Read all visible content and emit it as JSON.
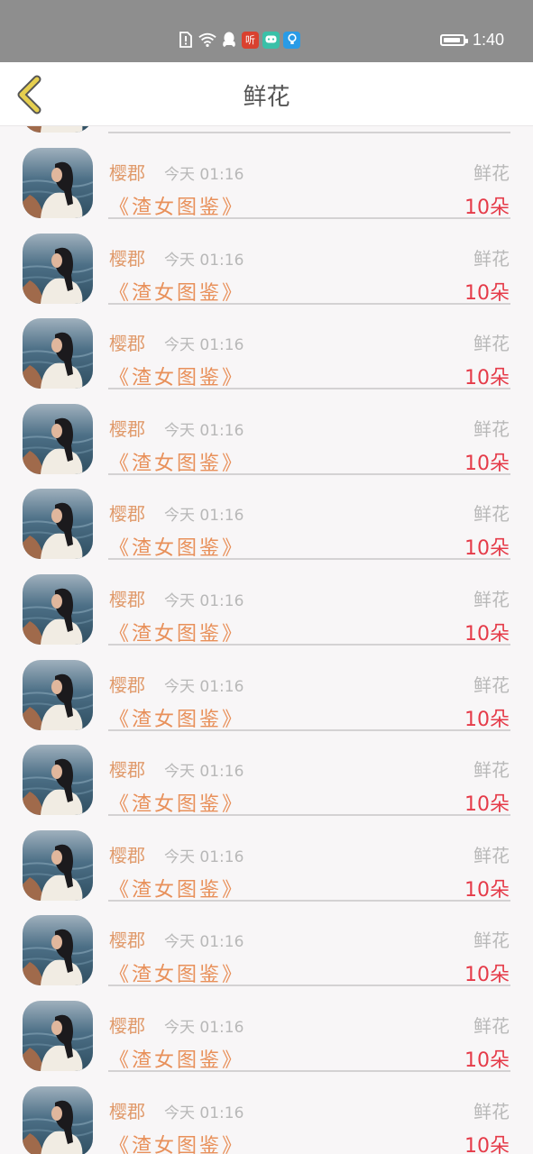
{
  "status_bar": {
    "time": "1:40",
    "battery_percent": 90,
    "icons": [
      "sim-alert-icon",
      "wifi-icon",
      "qq-icon",
      "ting-app-icon",
      "chat-app-icon",
      "bulb-app-icon"
    ],
    "apps": {
      "ting": "听"
    }
  },
  "header": {
    "title": "鲜花",
    "back_icon": "chevron-left-icon"
  },
  "colors": {
    "accent_name": "#e09a6b",
    "quantity": "#e53b49",
    "back_icon": "#e6cf4f"
  },
  "rows": [
    {
      "user": "樱郡",
      "time": "今天 01:16",
      "gift": "鲜花",
      "book": "《渣女图鉴》",
      "quantity": "10朵"
    },
    {
      "user": "樱郡",
      "time": "今天 01:16",
      "gift": "鲜花",
      "book": "《渣女图鉴》",
      "quantity": "10朵"
    },
    {
      "user": "樱郡",
      "time": "今天 01:16",
      "gift": "鲜花",
      "book": "《渣女图鉴》",
      "quantity": "10朵"
    },
    {
      "user": "樱郡",
      "time": "今天 01:16",
      "gift": "鲜花",
      "book": "《渣女图鉴》",
      "quantity": "10朵"
    },
    {
      "user": "樱郡",
      "time": "今天 01:16",
      "gift": "鲜花",
      "book": "《渣女图鉴》",
      "quantity": "10朵"
    },
    {
      "user": "樱郡",
      "time": "今天 01:16",
      "gift": "鲜花",
      "book": "《渣女图鉴》",
      "quantity": "10朵"
    },
    {
      "user": "樱郡",
      "time": "今天 01:16",
      "gift": "鲜花",
      "book": "《渣女图鉴》",
      "quantity": "10朵"
    },
    {
      "user": "樱郡",
      "time": "今天 01:16",
      "gift": "鲜花",
      "book": "《渣女图鉴》",
      "quantity": "10朵"
    },
    {
      "user": "樱郡",
      "time": "今天 01:16",
      "gift": "鲜花",
      "book": "《渣女图鉴》",
      "quantity": "10朵"
    },
    {
      "user": "樱郡",
      "time": "今天 01:16",
      "gift": "鲜花",
      "book": "《渣女图鉴》",
      "quantity": "10朵"
    },
    {
      "user": "樱郡",
      "time": "今天 01:16",
      "gift": "鲜花",
      "book": "《渣女图鉴》",
      "quantity": "10朵"
    },
    {
      "user": "樱郡",
      "time": "今天 01:16",
      "gift": "鲜花",
      "book": "《渣女图鉴》",
      "quantity": "10朵"
    }
  ]
}
